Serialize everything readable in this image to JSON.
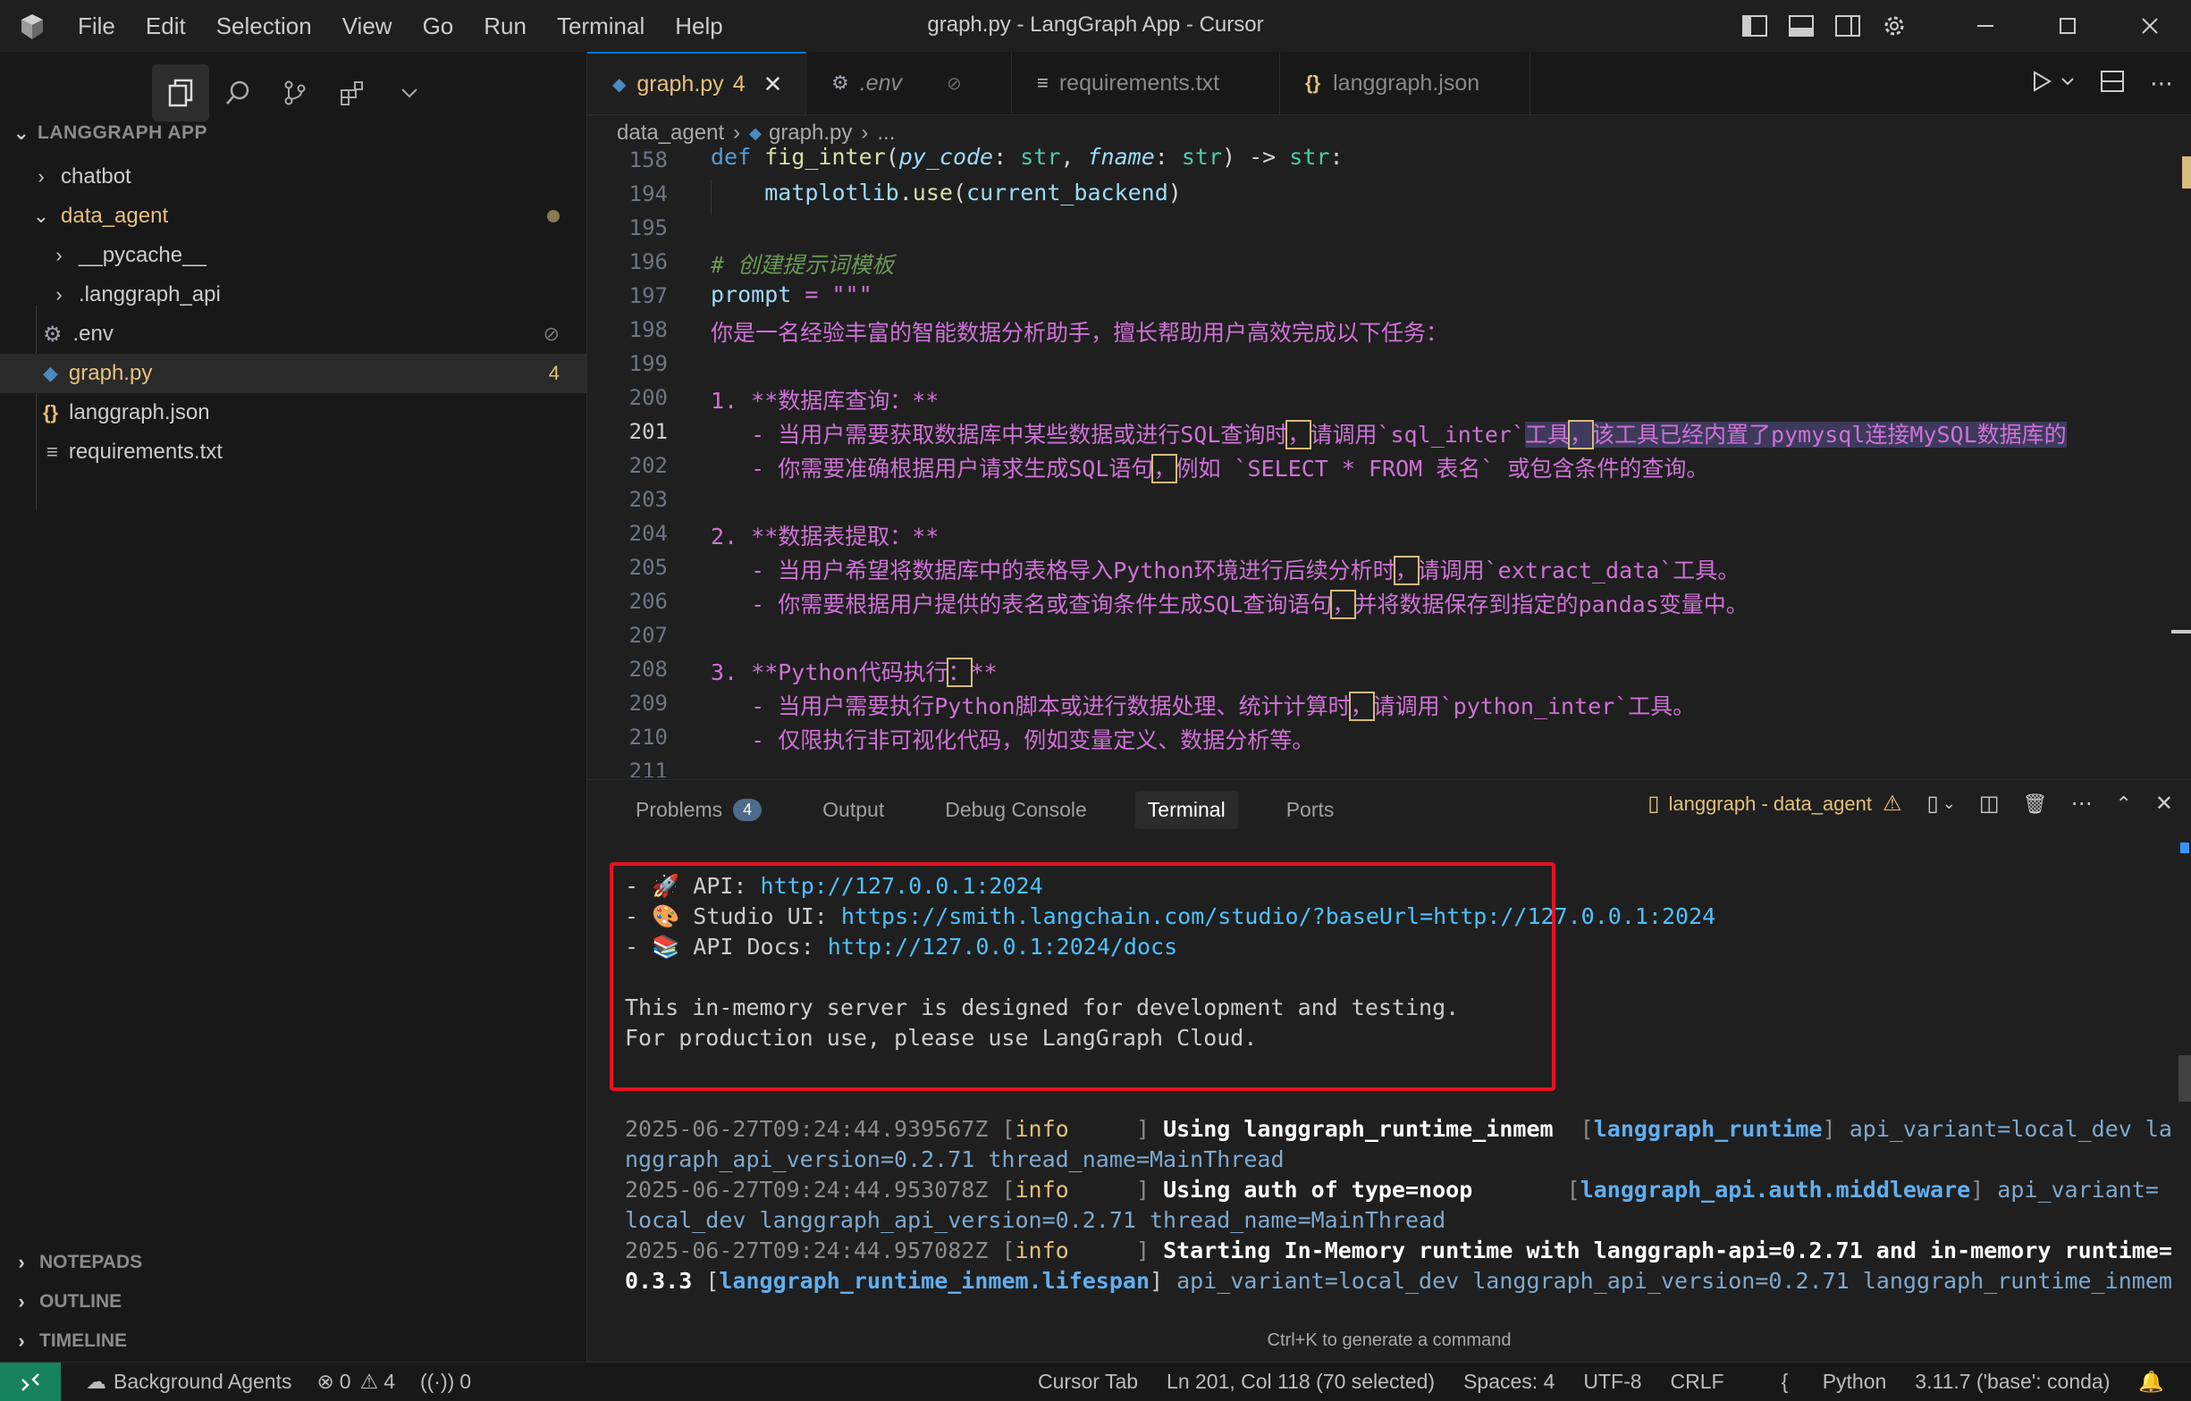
{
  "window": {
    "title": "graph.py - LangGraph App - Cursor"
  },
  "menu": [
    "File",
    "Edit",
    "Selection",
    "View",
    "Go",
    "Run",
    "Terminal",
    "Help"
  ],
  "explorer": {
    "header": "LANGGRAPH APP",
    "items": [
      {
        "label": "chatbot",
        "type": "folder"
      },
      {
        "label": "data_agent",
        "type": "folder-open"
      },
      {
        "label": "__pycache__",
        "type": "folder"
      },
      {
        "label": ".langgraph_api",
        "type": "folder"
      },
      {
        "label": ".env",
        "type": "file"
      },
      {
        "label": "graph.py",
        "type": "file",
        "badge": "4"
      },
      {
        "label": "langgraph.json",
        "type": "file"
      },
      {
        "label": "requirements.txt",
        "type": "file"
      }
    ],
    "sections": [
      "NOTEPADS",
      "OUTLINE",
      "TIMELINE"
    ]
  },
  "tabs": [
    {
      "label": "graph.py",
      "badge": "4",
      "icon": "python-icon"
    },
    {
      "label": ".env",
      "icon": "gear-icon"
    },
    {
      "label": "requirements.txt",
      "icon": "lines-icon"
    },
    {
      "label": "langgraph.json",
      "icon": "braces-icon"
    }
  ],
  "breadcrumb": {
    "folder": "data_agent",
    "file": "graph.py",
    "more": "..."
  },
  "editor": {
    "line_numbers": [
      "158",
      "194",
      "195",
      "196",
      "197",
      "198",
      "199",
      "200",
      "201",
      "202",
      "203",
      "204",
      "205",
      "206",
      "207",
      "208",
      "209",
      "210",
      "211"
    ],
    "sticky": {
      "def": "def",
      "fname": "fig_inter",
      "p1": "py_code",
      "t1": "str",
      "p2": "fname",
      "t2": "str",
      "ret": "str"
    },
    "l194_a": "matplotlib",
    "l194_b": "use",
    "l194_c": "current_backend",
    "l196": "# 创建提示词模板",
    "l197_var": "prompt",
    "l197_rest": " = \"\"\"",
    "l198": "你是一名经验丰富的智能数据分析助手，擅长帮助用户高效完成以下任务：",
    "l200": "1. **数据库查询：**",
    "l201_a": "   - 当用户需要获取数据库中某些数据或进行SQL查询时",
    "l201_b": "，",
    "l201_c": "请调用`sql_inter`",
    "l201_d": "工具",
    "l201_e": "，",
    "l201_f": "该工具已经内置了pymysql连接MySQL数据库的",
    "l202_a": "   - 你需要准确根据用户请求生成SQL语句",
    "l202_b": "，",
    "l202_c": "例如 `SELECT * FROM 表名` 或包含条件的查询。",
    "l204": "2. **数据表提取：**",
    "l205_a": "   - 当用户希望将数据库中的表格导入Python环境进行后续分析时",
    "l205_b": "，",
    "l205_c": "请调用`extract_data`工具。",
    "l206_a": "   - 你需要根据用户提供的表名或查询条件生成SQL查询语句",
    "l206_b": "，",
    "l206_c": "并将数据保存到指定的pandas变量中。",
    "l208_a": "3. **Python代码执行",
    "l208_b": "：",
    "l208_c": "**",
    "l209_a": "   - 当用户需要执行Python脚本或进行数据处理、统计计算时",
    "l209_b": "，",
    "l209_c": "请调用`python_inter`工具。",
    "l210": "   - 仅限执行非可视化代码，例如变量定义、数据分析等。"
  },
  "panel": {
    "tabs": [
      "Problems",
      "Output",
      "Debug Console",
      "Terminal",
      "Ports"
    ],
    "problems_count": "4",
    "terminal_name": "langgraph - data_agent",
    "hint": "Ctrl+K to generate a command"
  },
  "terminal": {
    "api_prefix": "- 🚀 API: ",
    "api_url": "http://127.0.0.1:2024",
    "studio_prefix": "- 🎨 Studio UI: ",
    "studio_url": "https://smith.langchain.com/studio/?baseUrl=http://127.0.0.1:2024",
    "docs_prefix": "- 📚 API Docs: ",
    "docs_url": "http://127.0.0.1:2024/docs",
    "note1": "This in-memory server is designed for development and testing.",
    "note2": "For production use, please use LangGraph Cloud.",
    "log1_ts": "2025-06-27T09:24:44.939567Z",
    "log1_lvl": "info",
    "log1_msg": "Using langgraph_runtime_inmem",
    "log1_mod": "langgraph_runtime",
    "log1_kv": "api_variant=local_dev la",
    "log1b": "nggraph_api_version=0.2.71 thread_name=MainThread",
    "log2_ts": "2025-06-27T09:24:44.953078Z",
    "log2_lvl": "info",
    "log2_msg": "Using auth of type=noop",
    "log2_mod": "langgraph_api.auth.middleware",
    "log2_kv": "api_variant=",
    "log2b": "local_dev langgraph_api_version=0.2.71 thread_name=MainThread",
    "log3_ts": "2025-06-27T09:24:44.957082Z",
    "log3_lvl": "info",
    "log3_msg": "Starting In-Memory runtime with langgraph-api=0.2.71 and in-memory runtime=",
    "log3b_a": "0.3.3",
    "log3b_mod": "langgraph_runtime_inmem.lifespan",
    "log3b_kv": "api_variant=local_dev langgraph_api_version=0.2.71 langgraph_runtime_inmem"
  },
  "status": {
    "agents": "Background Agents",
    "errors": "0",
    "warnings": "4",
    "ports": "0",
    "cursor_tab": "Cursor Tab",
    "position": "Ln 201, Col 118 (70 selected)",
    "spaces": "Spaces: 4",
    "encoding": "UTF-8",
    "eol": "CRLF",
    "language": "Python",
    "interpreter": "3.11.7 ('base': conda)"
  },
  "colors": {
    "accent": "#0078d4",
    "highlight_box": "#e81123",
    "remote": "#16825d"
  }
}
